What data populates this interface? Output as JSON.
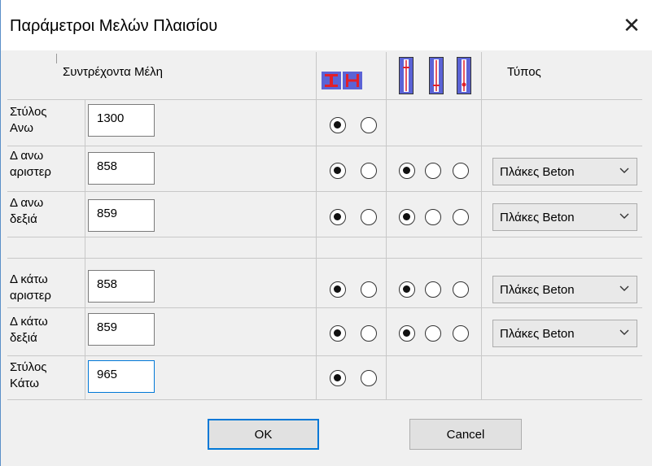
{
  "window": {
    "title": "Παράμετροι Μελών Πλαισίου",
    "close_glyph": "✕"
  },
  "header": {
    "members_label": "Συντρέχοντα Μέλη",
    "type_label": "Τύπος",
    "profile_icons": [
      "i-beam-icon",
      "h-beam-icon"
    ],
    "position_icons": [
      "position-top-icon",
      "position-bottom-icon",
      "position-center-icon"
    ]
  },
  "rows": [
    {
      "label_line1": "Στύλος",
      "label_line2": "Ανω",
      "value": "1300",
      "profile_selected": 0
    },
    {
      "label_line1": "Δ ανω",
      "label_line2": "αριστερ",
      "value": "858",
      "profile_selected": 0,
      "position_selected": 0,
      "type": "Πλάκες Beton"
    },
    {
      "label_line1": "Δ ανω",
      "label_line2": "δεξιά",
      "value": "859",
      "profile_selected": 0,
      "position_selected": 0,
      "type": "Πλάκες Beton"
    },
    {
      "label_line1": "Δ κάτω",
      "label_line2": "αριστερ",
      "value": "858",
      "profile_selected": 0,
      "position_selected": 0,
      "type": "Πλάκες Beton"
    },
    {
      "label_line1": "Δ κάτω",
      "label_line2": "δεξιά",
      "value": "859",
      "profile_selected": 0,
      "position_selected": 0,
      "type": "Πλάκες Beton"
    },
    {
      "label_line1": "Στύλος",
      "label_line2": "Κάτω",
      "value": "965",
      "profile_selected": 0
    }
  ],
  "buttons": {
    "ok_label": "OK",
    "cancel_label": "Cancel"
  },
  "colors": {
    "accent": "#0078d7",
    "icon_fill": "#5b63d6",
    "icon_red": "#e0202a"
  }
}
